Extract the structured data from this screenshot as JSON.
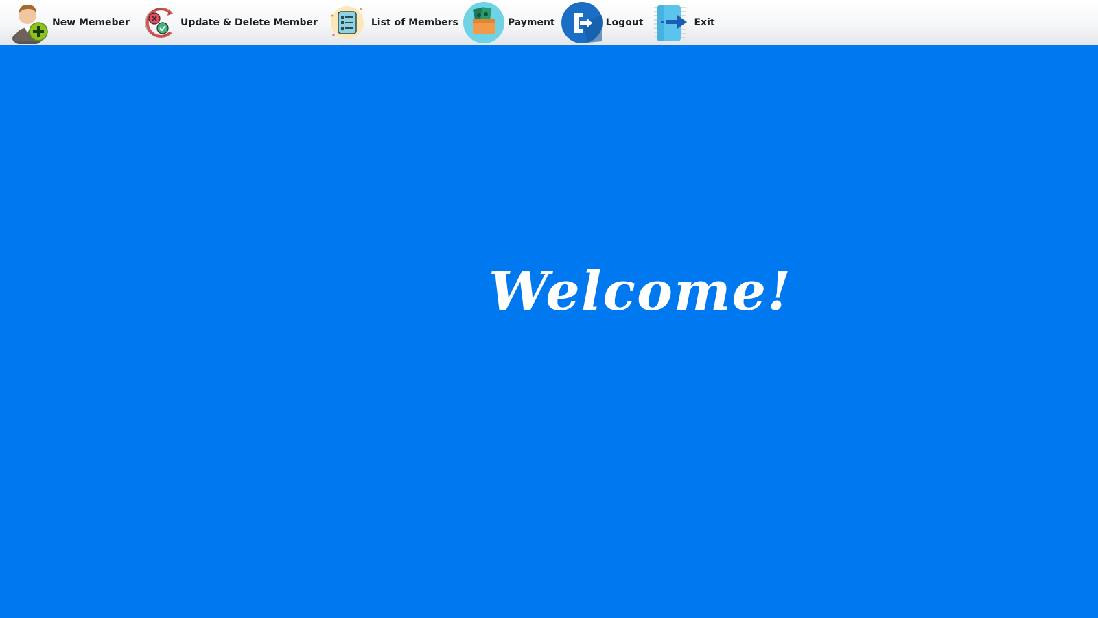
{
  "toolbar": {
    "items": [
      {
        "label": "New Memeber",
        "icon": "add-user-icon"
      },
      {
        "label": "Update & Delete Member",
        "icon": "update-delete-icon"
      },
      {
        "label": "List of Members",
        "icon": "list-icon"
      },
      {
        "label": "Payment",
        "icon": "wallet-icon"
      },
      {
        "label": "Logout",
        "icon": "logout-icon"
      },
      {
        "label": "Exit",
        "icon": "exit-icon"
      }
    ]
  },
  "main": {
    "welcome_text": "Welcome!"
  },
  "colors": {
    "background": "#0078f0",
    "toolbar": "#f4f5f7",
    "welcome_text": "#ffffff"
  }
}
